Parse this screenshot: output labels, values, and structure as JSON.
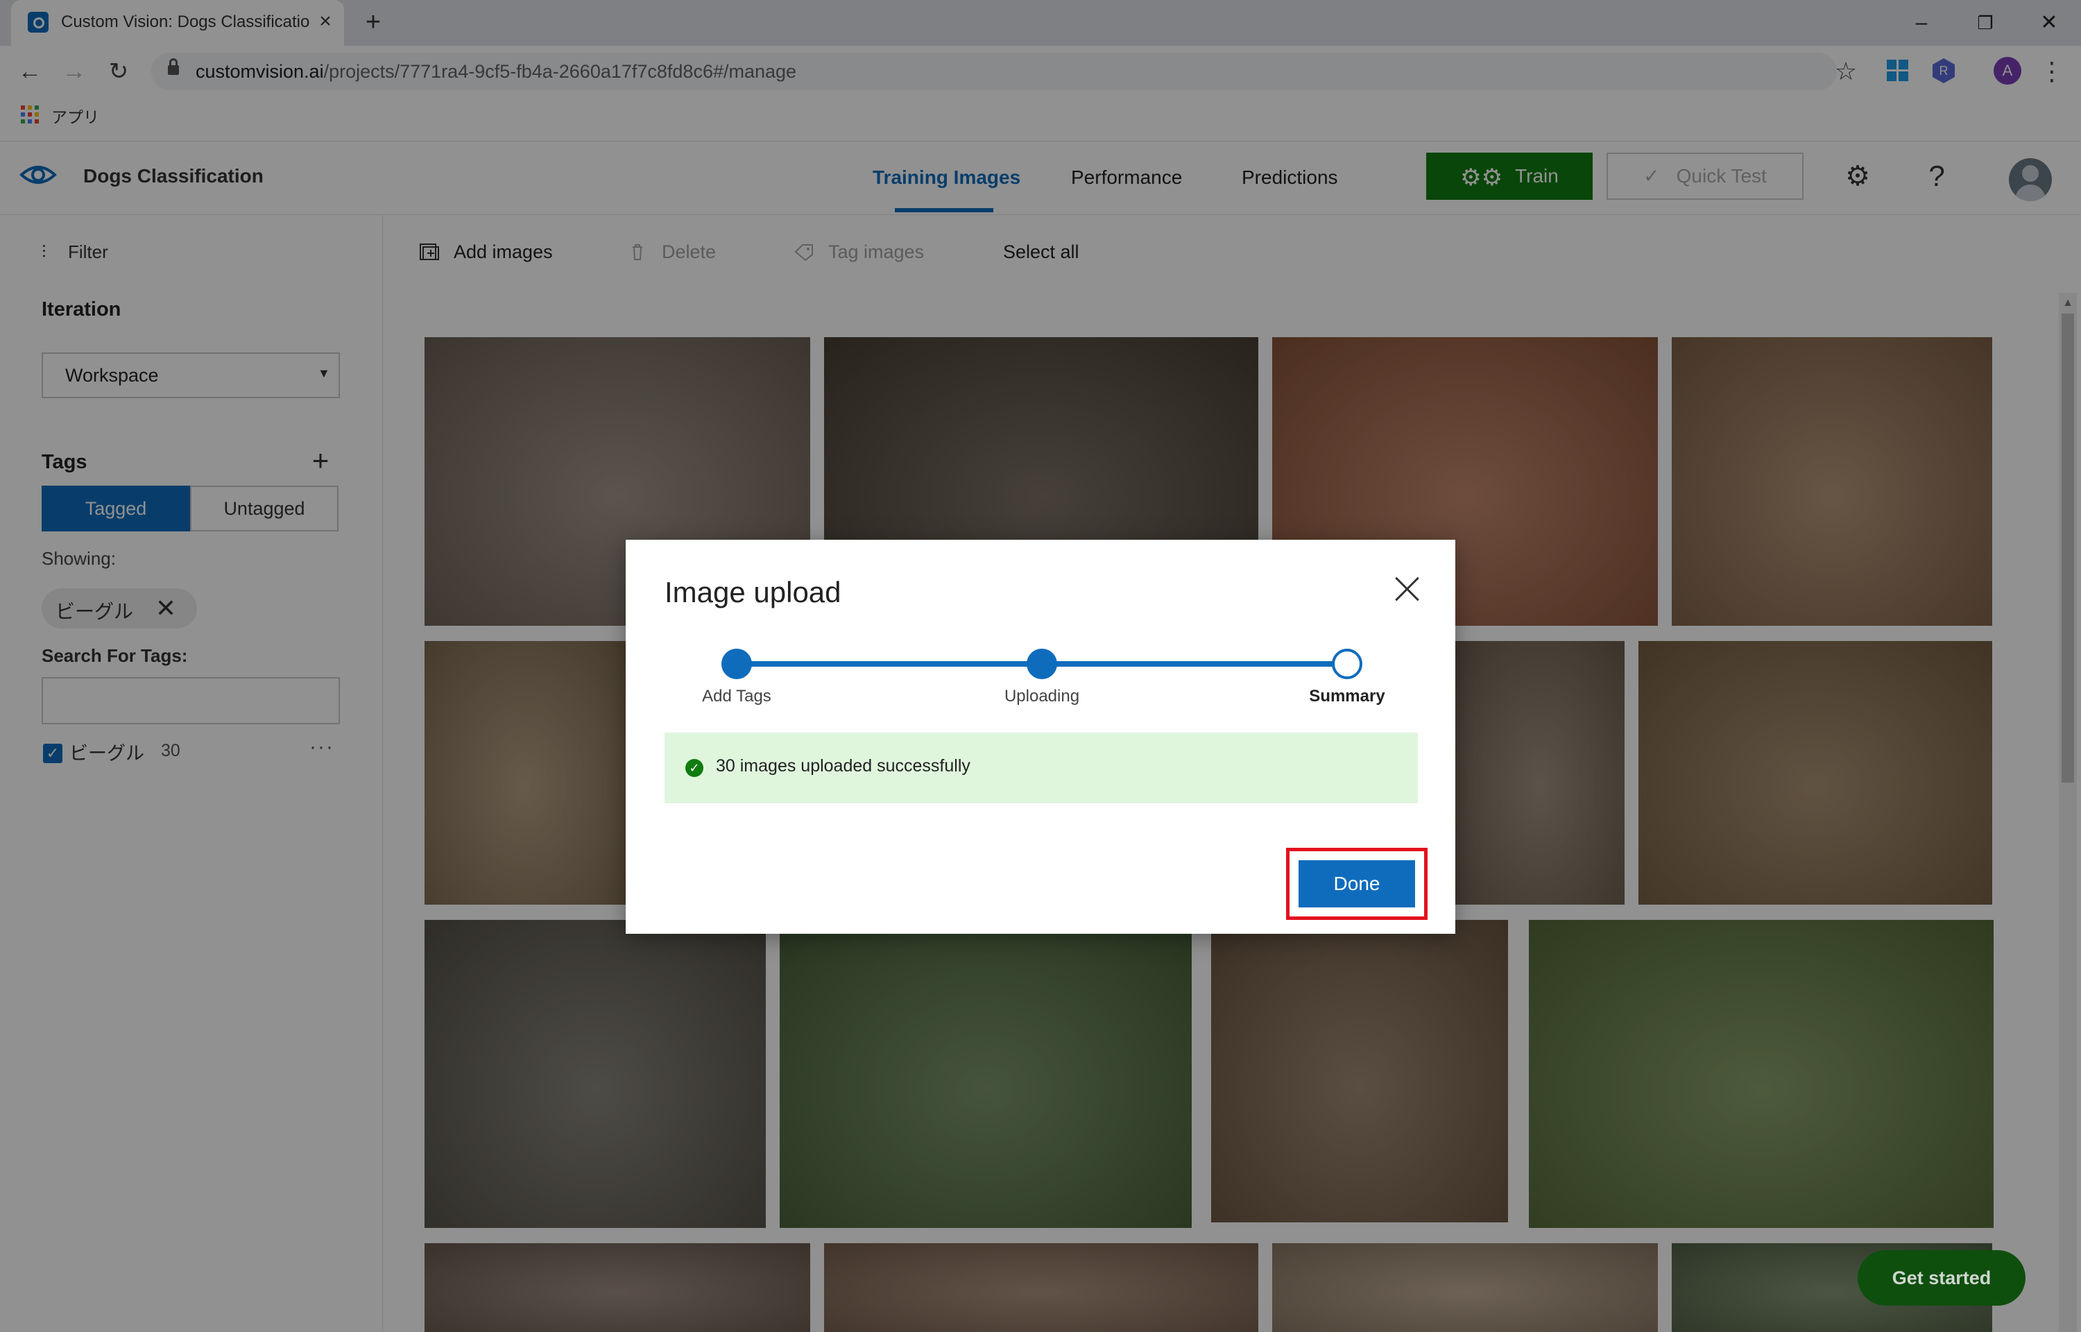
{
  "browser": {
    "tab_title": "Custom Vision: Dogs Classification",
    "tab_close": "×",
    "new_tab": "+",
    "window": {
      "minimize": "–",
      "restore": "❐",
      "close": "✕"
    },
    "nav": {
      "back": "←",
      "forward": "→",
      "reload": "↻"
    },
    "url_host": "customvision.ai",
    "url_path": "/projects/7771ra4-9cf5-fb4a-2660a17f7c8fd8c6#/manage",
    "bookmark": "アプリ",
    "star": "☆",
    "profile_initial": "A",
    "extension_letter": "R",
    "menu": "⋮"
  },
  "header": {
    "project_name": "Dogs Classification",
    "tabs": {
      "training": "Training Images",
      "performance": "Performance",
      "predictions": "Predictions"
    },
    "train_label": "Train",
    "quick_test_label": "Quick Test",
    "settings_glyph": "⚙",
    "help_glyph": "?"
  },
  "sidebar": {
    "filter_label": "Filter",
    "iteration_label": "Iteration",
    "iteration_value": "Workspace",
    "tags_label": "Tags",
    "add_tag_glyph": "+",
    "tagged_label": "Tagged",
    "untagged_label": "Untagged",
    "showing_label": "Showing:",
    "showing_tag": "ビーグル",
    "search_label": "Search For Tags:",
    "search_value": "",
    "tag_row": {
      "checked": true,
      "name": "ビーグル",
      "count": "30",
      "more": "···"
    }
  },
  "actions": {
    "add_images": "Add images",
    "delete": "Delete",
    "tag_images": "Tag images",
    "select_all": "Select all"
  },
  "thumbnails": [
    {
      "bg": "#8b7d6f"
    },
    {
      "bg": "#5e5244"
    },
    {
      "bg": "#b26d4c"
    },
    {
      "bg": "#a57f5c"
    },
    {
      "bg": "#a48a6a"
    },
    {
      "bg": "#8d7a66"
    },
    {
      "bg": "#987a55"
    },
    {
      "bg": "#6f6a5f"
    },
    {
      "bg": "#5d7d4a"
    },
    {
      "bg": "#8a6f55"
    },
    {
      "bg": "#6f8a4a"
    },
    {
      "bg": "#8a7466"
    },
    {
      "bg": "#9a7b64"
    },
    {
      "bg": "#b39a80"
    },
    {
      "bg": "#6b7f5a"
    }
  ],
  "modal": {
    "title": "Image upload",
    "steps": [
      "Add Tags",
      "Uploading",
      "Summary"
    ],
    "success_icon": "✓",
    "success_text": "30 images uploaded successfully",
    "done_label": "Done"
  },
  "get_started_label": "Get started",
  "colors": {
    "accent": "#0f6cbd",
    "train": "#107c10",
    "success_bg": "#dff6dd",
    "highlight": "#e3101f"
  }
}
